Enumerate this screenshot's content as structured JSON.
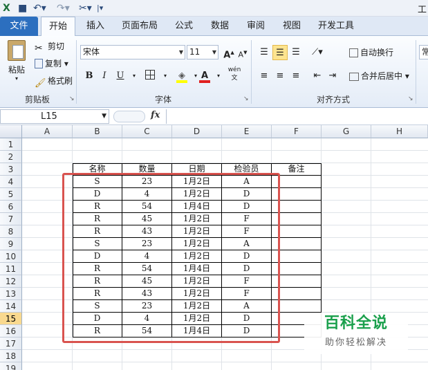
{
  "qat": {
    "title_char": "工"
  },
  "tabs": [
    "文件",
    "开始",
    "插入",
    "页面布局",
    "公式",
    "数据",
    "审阅",
    "视图",
    "开发工具"
  ],
  "ribbon": {
    "clipboard": {
      "paste": "粘贴",
      "cut": "剪切",
      "copy": "复制",
      "format_painter": "格式刷",
      "label": "剪贴板"
    },
    "font": {
      "name": "宋体",
      "size": "11",
      "bold": "B",
      "italic": "I",
      "underline": "U",
      "label": "字体",
      "font_color_glyph": "A",
      "wen_glyph": "wén 文"
    },
    "alignment": {
      "wrap": "自动换行",
      "merge": "合并后居中",
      "label": "对齐方式"
    },
    "number_partial": "常"
  },
  "formula_bar": {
    "name_box": "L15",
    "fx": "fx",
    "value": ""
  },
  "columns": [
    "A",
    "B",
    "C",
    "D",
    "E",
    "F",
    "G",
    "H"
  ],
  "rows": [
    "1",
    "2",
    "3",
    "4",
    "5",
    "6",
    "7",
    "8",
    "9",
    "10",
    "11",
    "12",
    "13",
    "14",
    "15",
    "16",
    "17",
    "18",
    "19"
  ],
  "selected_row": "15",
  "table": {
    "headers": [
      "名称",
      "数量",
      "日期",
      "检验员",
      "备注"
    ],
    "rows": [
      [
        "S",
        "23",
        "1月2日",
        "A",
        ""
      ],
      [
        "D",
        "4",
        "1月2日",
        "D",
        ""
      ],
      [
        "R",
        "54",
        "1月4日",
        "D",
        ""
      ],
      [
        "R",
        "45",
        "1月2日",
        "F",
        ""
      ],
      [
        "R",
        "43",
        "1月2日",
        "F",
        ""
      ],
      [
        "S",
        "23",
        "1月2日",
        "A",
        ""
      ],
      [
        "D",
        "4",
        "1月2日",
        "D",
        ""
      ],
      [
        "R",
        "54",
        "1月4日",
        "D",
        ""
      ],
      [
        "R",
        "45",
        "1月2日",
        "F",
        ""
      ],
      [
        "R",
        "43",
        "1月2日",
        "F",
        ""
      ],
      [
        "S",
        "23",
        "1月2日",
        "A",
        ""
      ],
      [
        "D",
        "4",
        "1月2日",
        "D",
        ""
      ],
      [
        "R",
        "54",
        "1月4日",
        "D",
        ""
      ]
    ]
  },
  "watermark": {
    "line1": "百科全说",
    "line2": "助你轻松解决"
  },
  "colors": {
    "file_tab": "#2c6fbf",
    "highlight_box": "#d9534f",
    "watermark": "#1aa04c"
  }
}
